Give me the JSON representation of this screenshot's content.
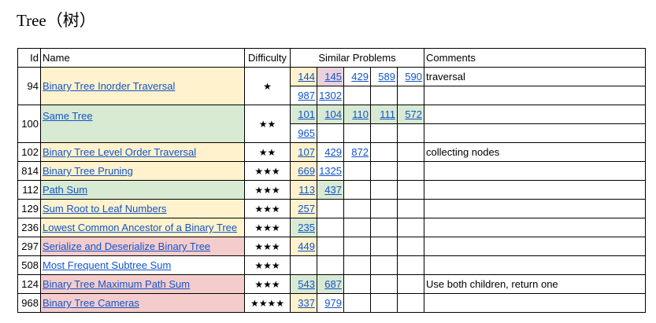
{
  "title": "Tree（树）",
  "headers": {
    "id": "Id",
    "name": "Name",
    "difficulty": "Difficulty",
    "similar": "Similar Problems",
    "comments": "Comments"
  },
  "colors": {
    "yellow": "#fff2cc",
    "green": "#d9ead3",
    "red": "#f4cccc",
    "pink": "#ead1dc",
    "link": "#1155cc"
  },
  "problems": [
    {
      "id": "94",
      "name": "Binary Tree Inorder Traversal",
      "difficulty": "★",
      "color": "yellow",
      "similar_row1": [
        "144",
        "145",
        "429",
        "589",
        "590"
      ],
      "similar_row2": [
        "987",
        "1302"
      ],
      "comment": "traversal"
    },
    {
      "id": "100",
      "name": "Same Tree",
      "difficulty": "★★",
      "color": "green",
      "similar_row1": [
        "101",
        "104",
        "110",
        "111",
        "572"
      ],
      "similar_row2": [
        "965"
      ],
      "comment": ""
    },
    {
      "id": "102",
      "name": "Binary Tree Level Order Traversal",
      "difficulty": "★★",
      "color": "yellow",
      "similar": [
        "107",
        "429",
        "872"
      ],
      "comment": "collecting nodes"
    },
    {
      "id": "814",
      "name": "Binary Tree Pruning",
      "difficulty": "★★★",
      "color": "yellow",
      "similar": [
        "669",
        "1325"
      ],
      "comment": ""
    },
    {
      "id": "112",
      "name": "Path Sum",
      "difficulty": "★★★",
      "color": "green",
      "similar": [
        "113",
        "437"
      ],
      "comment": ""
    },
    {
      "id": "129",
      "name": "Sum Root to Leaf Numbers",
      "difficulty": "★★★",
      "color": "yellow",
      "similar": [
        "257"
      ],
      "comment": ""
    },
    {
      "id": "236",
      "name": "Lowest Common Ancestor of a Binary Tree",
      "difficulty": "★★★",
      "color": "yellow",
      "similar": [
        "235"
      ],
      "comment": ""
    },
    {
      "id": "297",
      "name": "Serialize and Deserialize Binary Tree",
      "difficulty": "★★★",
      "color": "red",
      "similar": [
        "449"
      ],
      "comment": ""
    },
    {
      "id": "508",
      "name": "Most Frequent Subtree Sum",
      "difficulty": "★★★",
      "color": "none",
      "similar": [],
      "comment": ""
    },
    {
      "id": "124",
      "name": "Binary Tree Maximum Path Sum",
      "difficulty": "★★★",
      "color": "red",
      "similar": [
        "543",
        "687"
      ],
      "comment": "Use both children, return one"
    },
    {
      "id": "968",
      "name": "Binary Tree Cameras",
      "difficulty": "★★★★",
      "color": "red",
      "similar": [
        "337",
        "979"
      ],
      "comment": ""
    }
  ]
}
